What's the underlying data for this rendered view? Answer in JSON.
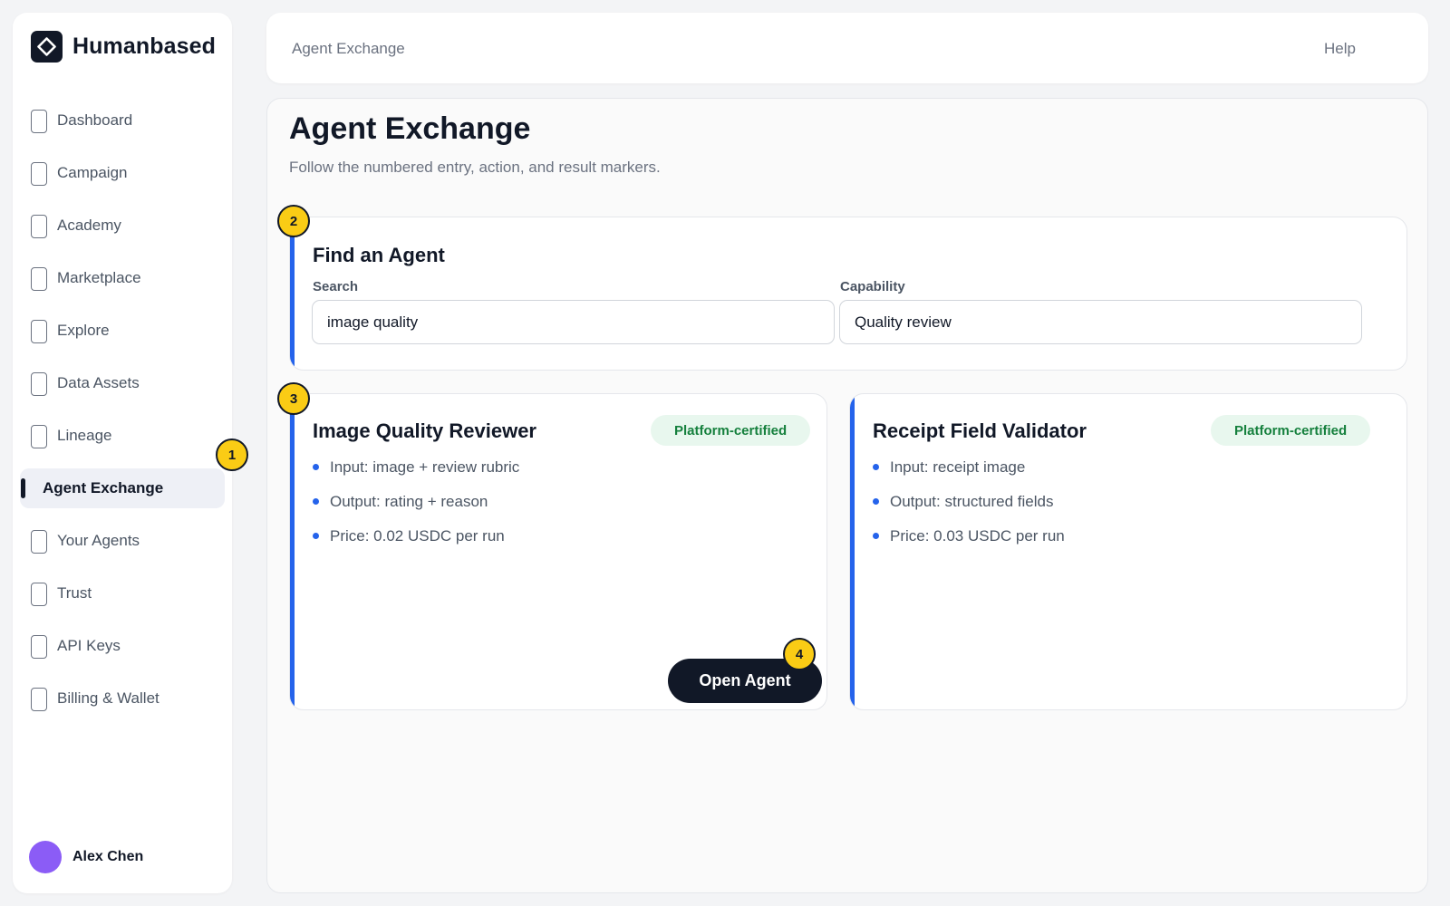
{
  "brand": {
    "name": "Humanbased"
  },
  "sidebar": {
    "items": [
      {
        "label": "Dashboard"
      },
      {
        "label": "Campaign"
      },
      {
        "label": "Academy"
      },
      {
        "label": "Marketplace"
      },
      {
        "label": "Explore"
      },
      {
        "label": "Data Assets"
      },
      {
        "label": "Lineage"
      },
      {
        "label": "Agent Exchange",
        "active": true
      },
      {
        "label": "Your Agents"
      },
      {
        "label": "Trust"
      },
      {
        "label": "API Keys"
      },
      {
        "label": "Billing & Wallet"
      }
    ]
  },
  "user": {
    "name": "Alex Chen",
    "avatar_color": "#8b5cf6"
  },
  "topbar": {
    "breadcrumb": "Agent Exchange",
    "help_label": "Help"
  },
  "main": {
    "title": "Agent Exchange",
    "subtitle": "Follow the numbered entry, action, and result markers."
  },
  "find": {
    "title": "Find an Agent",
    "search_label": "Search",
    "search_value": "image quality",
    "capability_label": "Capability",
    "capability_value": "Quality review"
  },
  "agents": [
    {
      "name": "Image Quality Reviewer",
      "badge": "Platform-certified",
      "specs": [
        "Input: image + review rubric",
        "Output: rating + reason",
        "Price: 0.02 USDC per run"
      ],
      "action_label": "Open Agent"
    },
    {
      "name": "Receipt Field Validator",
      "badge": "Platform-certified",
      "specs": [
        "Input: receipt image",
        "Output: structured fields",
        "Price: 0.03 USDC per run"
      ]
    }
  ],
  "markers": [
    "1",
    "2",
    "3",
    "4"
  ],
  "colors": {
    "accent": "#2563eb",
    "marker": "#facc15",
    "badge_bg": "#e8f7ee",
    "badge_text": "#15803d",
    "dark": "#111827"
  }
}
